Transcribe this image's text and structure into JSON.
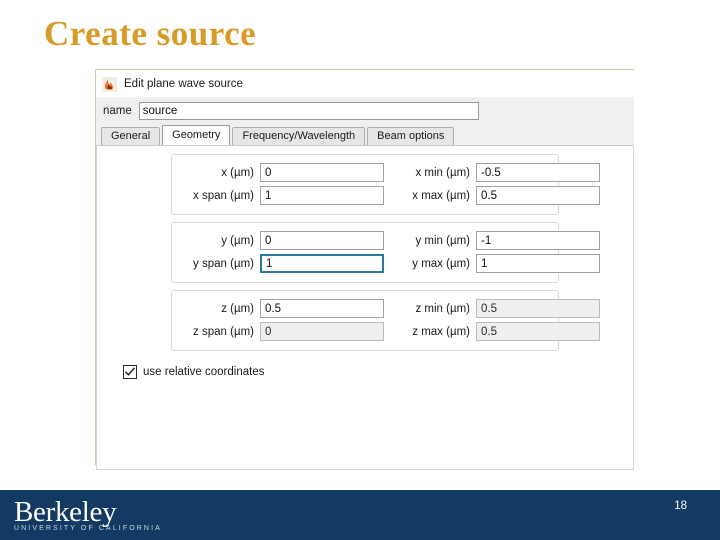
{
  "slide": {
    "title": "Create source",
    "title_color": "#d99b28",
    "page_number": "18"
  },
  "dialog": {
    "icon": "lumerical-flame-icon",
    "title": "Edit plane wave source",
    "name_label": "name",
    "name_value": "source",
    "tabs": [
      {
        "label": "General",
        "active": false
      },
      {
        "label": "Geometry",
        "active": true
      },
      {
        "label": "Frequency/Wavelength",
        "active": false
      },
      {
        "label": "Beam options",
        "active": false
      }
    ],
    "groups": [
      {
        "axis": "x",
        "rows": [
          {
            "left": {
              "label": "x (µm)",
              "value": "0",
              "state": "normal"
            },
            "right": {
              "label": "x min (µm)",
              "value": "-0.5",
              "state": "normal"
            }
          },
          {
            "left": {
              "label": "x span (µm)",
              "value": "1",
              "state": "normal"
            },
            "right": {
              "label": "x max (µm)",
              "value": "0.5",
              "state": "normal"
            }
          }
        ]
      },
      {
        "axis": "y",
        "rows": [
          {
            "left": {
              "label": "y (µm)",
              "value": "0",
              "state": "normal"
            },
            "right": {
              "label": "y min (µm)",
              "value": "-1",
              "state": "normal"
            }
          },
          {
            "left": {
              "label": "y span (µm)",
              "value": "1",
              "state": "focused"
            },
            "right": {
              "label": "y max (µm)",
              "value": "1",
              "state": "normal"
            }
          }
        ]
      },
      {
        "axis": "z",
        "rows": [
          {
            "left": {
              "label": "z (µm)",
              "value": "0.5",
              "state": "normal"
            },
            "right": {
              "label": "z min (µm)",
              "value": "0.5",
              "state": "disabled"
            }
          },
          {
            "left": {
              "label": "z span (µm)",
              "value": "0",
              "state": "disabled"
            },
            "right": {
              "label": "z max (µm)",
              "value": "0.5",
              "state": "disabled"
            }
          }
        ]
      }
    ],
    "relative_coords": {
      "label": "use relative coordinates",
      "checked": true,
      "icon": "checkmark-icon"
    }
  },
  "footer": {
    "wordmark": "Berkeley",
    "subtitle": "UNIVERSITY OF CALIFORNIA",
    "background": "#123a63"
  }
}
